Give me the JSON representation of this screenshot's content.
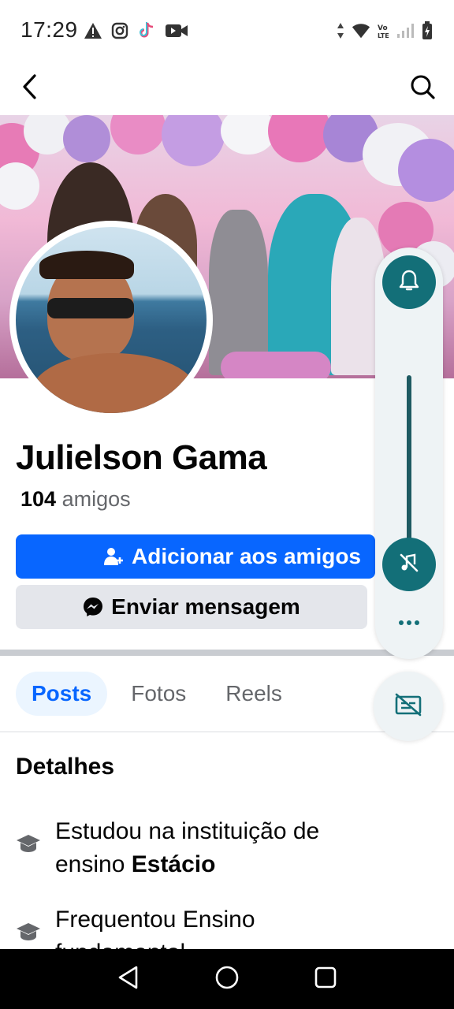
{
  "status_bar": {
    "time": "17:29",
    "left_icons": [
      "warning-icon",
      "instagram-icon",
      "tiktok-icon",
      "video-camera-icon"
    ],
    "right_icons": [
      "data-arrows-icon",
      "wifi-icon",
      "volte-icon",
      "signal-icon",
      "battery-charging-icon"
    ]
  },
  "nav": {
    "back_icon": "back-arrow-icon",
    "search_icon": "search-icon"
  },
  "profile": {
    "name": "Julielson Gama",
    "friends_count": "104",
    "friends_label": " amigos",
    "add_friend_label": "Adicionar aos amigos",
    "message_label": "Enviar mensagem"
  },
  "tabs": [
    {
      "label": "Posts",
      "active": true
    },
    {
      "label": "Fotos",
      "active": false
    },
    {
      "label": "Reels",
      "active": false
    }
  ],
  "details": {
    "title": "Detalhes",
    "items": [
      {
        "prefix": "Estudou na instituição de ensino ",
        "bold": "Estácio",
        "icon": "graduation-cap-icon"
      },
      {
        "prefix": "Frequentou Ensino fundamental",
        "bold": "",
        "icon": "graduation-cap-icon"
      }
    ]
  },
  "floating_panel": {
    "colors": {
      "accent": "#136f78",
      "panel_bg": "#eef3f5"
    },
    "icons": [
      "bell-icon",
      "mute-music-icon",
      "more-dots-icon",
      "caption-off-icon"
    ]
  },
  "colors": {
    "primary_button": "#0866ff",
    "secondary_button": "#e4e6eb",
    "tab_active_bg": "#ebf5ff"
  }
}
